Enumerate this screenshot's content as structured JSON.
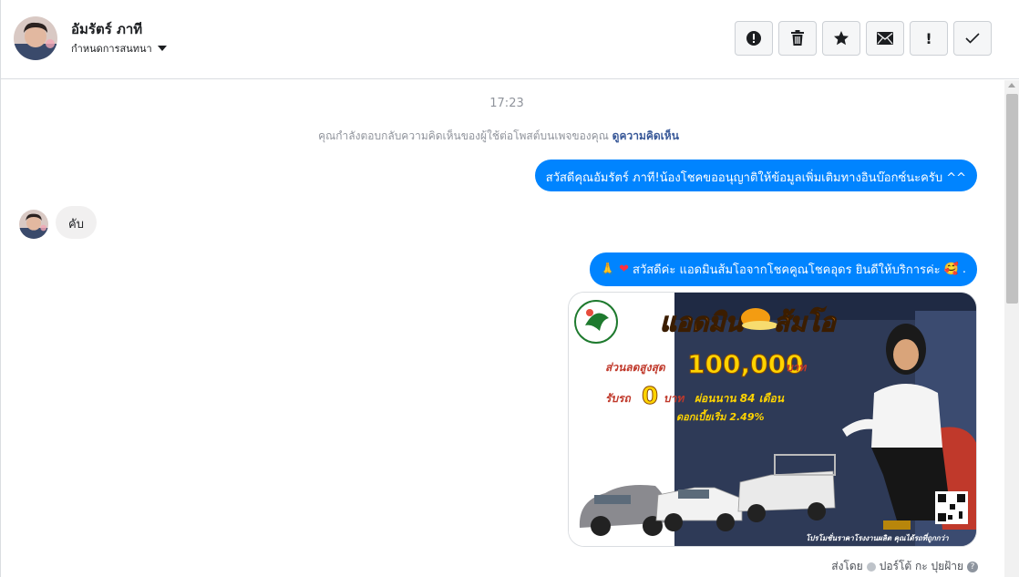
{
  "header": {
    "contact_name": "อัมรัตร์ ภาที",
    "assign_label": "กำหนดการสนทนา",
    "actions": [
      {
        "icon": "spam-icon"
      },
      {
        "icon": "trash-icon"
      },
      {
        "icon": "star-icon"
      },
      {
        "icon": "mail-icon"
      },
      {
        "icon": "exclamation-icon",
        "label": "!"
      },
      {
        "icon": "check-icon"
      }
    ]
  },
  "thread": {
    "timestamp": "17:23",
    "notice_text": "คุณกำลังตอบกลับความคิดเห็นของผู้ใช้ต่อโพสต์บนเพจของคุณ",
    "notice_link": "ดูความคิดเห็น",
    "messages": [
      {
        "from": "page",
        "text": "สวัสดีคุณอัมรัตร์ ภาที!น้องโชคขออนุญาติให้ข้อมูลเพิ่มเติมทางอินบ๊อกซ์นะครับ ^^"
      },
      {
        "from": "user",
        "text": "คับ"
      },
      {
        "from": "page",
        "emoji_pray": "🙏",
        "emoji_heart": "❤",
        "text": "สวัสดีค่ะ แอดมินส้มโอจากโชคคูณโชคอุดร ยินดีให้บริการค่ะ",
        "emoji_end": "🥰",
        "end_punct": "."
      }
    ],
    "image_ad": {
      "headline_1": "แอดมิน",
      "headline_2": "ส้มโอ",
      "discount_label": "ส่วนลดสูงสุด",
      "discount_value": "100,000",
      "discount_unit": "บาท",
      "down_label": "รับรถ",
      "down_value": "0",
      "down_unit": "บาท",
      "installment": "ผ่อนนาน 84 เดือน",
      "interest": "ดอกเบี้ยเริ่ม 2.49%",
      "footer": "โปรโมชั่นราคาโรงงานผลิต คุณได้รถที่ถูกกว่า"
    },
    "sent_by_label": "ส่งโดย",
    "sent_by_name": "ปอร์โต้ กะ ปุยฝ้าย"
  },
  "colors": {
    "accent": "#0084ff",
    "link": "#385898",
    "muted": "#90949c",
    "incoming_bubble": "#f1f0f0"
  }
}
